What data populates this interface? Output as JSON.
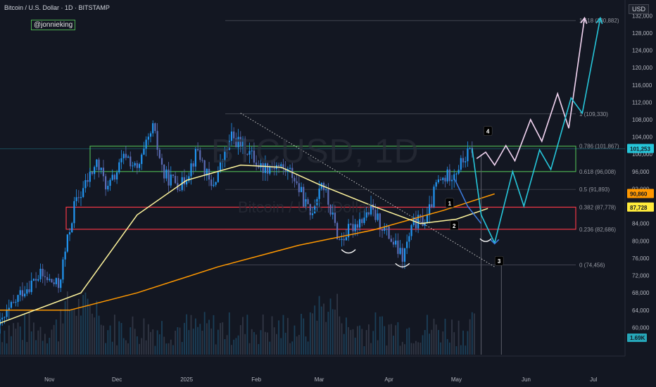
{
  "header": {
    "title": "Bitcoin / U.S. Dollar · 1D · BITSTAMP",
    "tag": "@jonnieking",
    "currency": "USD"
  },
  "watermark": {
    "symbol": "BTCUSD, 1D",
    "name": "Bitcoin / U.S. Dollar"
  },
  "chart_data": {
    "type": "candlestick",
    "y_ticks": [
      60000,
      64000,
      68000,
      72000,
      76000,
      80000,
      84000,
      88000,
      92000,
      96000,
      100000,
      104000,
      108000,
      112000,
      116000,
      120000,
      124000,
      128000,
      132000
    ],
    "y_tick_labels": [
      "60,000",
      "64,000",
      "68,000",
      "72,000",
      "76,000",
      "80,000",
      "84,000",
      "88,000",
      "92,000",
      "96,000",
      "100,000",
      "104,000",
      "108,000",
      "112,000",
      "116,000",
      "120,000",
      "124,000",
      "128,000",
      "132,000"
    ],
    "x_labels": [
      {
        "label": "Nov",
        "date": "2024-11-01"
      },
      {
        "label": "Dec",
        "date": "2024-12-01"
      },
      {
        "label": "2025",
        "date": "2025-01-01"
      },
      {
        "label": "Feb",
        "date": "2025-02-01"
      },
      {
        "label": "Mar",
        "date": "2025-03-01"
      },
      {
        "label": "Apr",
        "date": "2025-04-01"
      },
      {
        "label": "May",
        "date": "2025-05-01"
      },
      {
        "label": "Jun",
        "date": "2025-06-01"
      },
      {
        "label": "Jul",
        "date": "2025-07-01"
      }
    ],
    "price_path": [
      [
        "2024-10-10",
        60500
      ],
      [
        "2024-10-20",
        68500
      ],
      [
        "2024-10-28",
        72000
      ],
      [
        "2024-11-05",
        69500
      ],
      [
        "2024-11-12",
        88000
      ],
      [
        "2024-11-22",
        98000
      ],
      [
        "2024-11-27",
        92000
      ],
      [
        "2024-12-05",
        100000
      ],
      [
        "2024-12-10",
        96000
      ],
      [
        "2024-12-17",
        106000
      ],
      [
        "2024-12-22",
        95000
      ],
      [
        "2024-12-30",
        93000
      ],
      [
        "2025-01-06",
        101000
      ],
      [
        "2025-01-12",
        92000
      ],
      [
        "2025-01-21",
        104000
      ],
      [
        "2025-01-28",
        101000
      ],
      [
        "2025-02-03",
        97000
      ],
      [
        "2025-02-10",
        97500
      ],
      [
        "2025-02-17",
        95500
      ],
      [
        "2025-02-25",
        86000
      ],
      [
        "2025-03-02",
        94000
      ],
      [
        "2025-03-10",
        80000
      ],
      [
        "2025-03-17",
        84000
      ],
      [
        "2025-03-24",
        87000
      ],
      [
        "2025-03-31",
        82000
      ],
      [
        "2025-04-07",
        76000
      ],
      [
        "2025-04-12",
        84000
      ],
      [
        "2025-04-18",
        85000
      ],
      [
        "2025-04-22",
        93000
      ],
      [
        "2025-05-01",
        96500
      ],
      [
        "2025-05-08",
        101253
      ]
    ],
    "ma_yellow": [
      [
        "2024-10-10",
        61000
      ],
      [
        "2024-11-15",
        68000
      ],
      [
        "2024-12-10",
        86000
      ],
      [
        "2025-01-01",
        94000
      ],
      [
        "2025-01-25",
        97500
      ],
      [
        "2025-02-12",
        97000
      ],
      [
        "2025-03-01",
        93000
      ],
      [
        "2025-03-25",
        88000
      ],
      [
        "2025-04-15",
        84000
      ],
      [
        "2025-05-01",
        85000
      ],
      [
        "2025-05-15",
        87500
      ]
    ],
    "ma_orange": [
      [
        "2024-10-10",
        64000
      ],
      [
        "2024-11-10",
        64000
      ],
      [
        "2024-12-10",
        68000
      ],
      [
        "2025-01-15",
        74000
      ],
      [
        "2025-02-20",
        79000
      ],
      [
        "2025-03-25",
        82500
      ],
      [
        "2025-04-25",
        87000
      ],
      [
        "2025-05-18",
        90860
      ]
    ],
    "fib_levels": [
      {
        "label": "1.618 (130,882)",
        "value": 130882
      },
      {
        "label": "1 (109,330)",
        "value": 109330
      },
      {
        "label": "0.786 (101,867)",
        "value": 101867
      },
      {
        "label": "0.618 (96,008)",
        "value": 96008
      },
      {
        "label": "0.5 (91,893)",
        "value": 91893
      },
      {
        "label": "0.382 (87,778)",
        "value": 87778
      },
      {
        "label": "0.236 (82,686)",
        "value": 82686
      },
      {
        "label": "0 (74,456)",
        "value": 74456
      }
    ],
    "zones": [
      {
        "name": "green",
        "from": 96008,
        "to": 101867,
        "color": "#4caf50"
      },
      {
        "name": "red",
        "from": 82686,
        "to": 87778,
        "color": "#f23645"
      }
    ],
    "price_badges": [
      {
        "value": 101253,
        "label": "101,253",
        "color": "#26c6da"
      },
      {
        "value": 90860,
        "label": "90,860",
        "color": "#ff9800"
      },
      {
        "value": 87728,
        "label": "87,728",
        "color": "#ffeb3b"
      }
    ],
    "volume_badge": "1.69K",
    "wave_labels": [
      "1",
      "2",
      "3",
      "4"
    ],
    "projection_pink": [
      [
        "2025-05-10",
        99000
      ],
      [
        "2025-05-14",
        100500
      ],
      [
        "2025-05-18",
        97500
      ],
      [
        "2025-05-23",
        102000
      ],
      [
        "2025-05-27",
        98500
      ],
      [
        "2025-06-03",
        108000
      ],
      [
        "2025-06-08",
        103000
      ],
      [
        "2025-06-15",
        114000
      ],
      [
        "2025-06-20",
        106000
      ],
      [
        "2025-06-27",
        131500
      ]
    ],
    "projection_blue": [
      [
        "2025-05-08",
        101253
      ],
      [
        "2025-05-12",
        86000
      ],
      [
        "2025-05-18",
        79500
      ],
      [
        "2025-05-26",
        96000
      ],
      [
        "2025-05-31",
        88000
      ],
      [
        "2025-06-07",
        101000
      ],
      [
        "2025-06-12",
        96500
      ],
      [
        "2025-06-21",
        113000
      ],
      [
        "2025-06-26",
        109500
      ],
      [
        "2025-07-04",
        131500
      ]
    ],
    "projection_blue_short": [
      [
        "2025-04-30",
        94500
      ],
      [
        "2025-05-06",
        88000
      ],
      [
        "2025-05-12",
        84000
      ]
    ]
  }
}
